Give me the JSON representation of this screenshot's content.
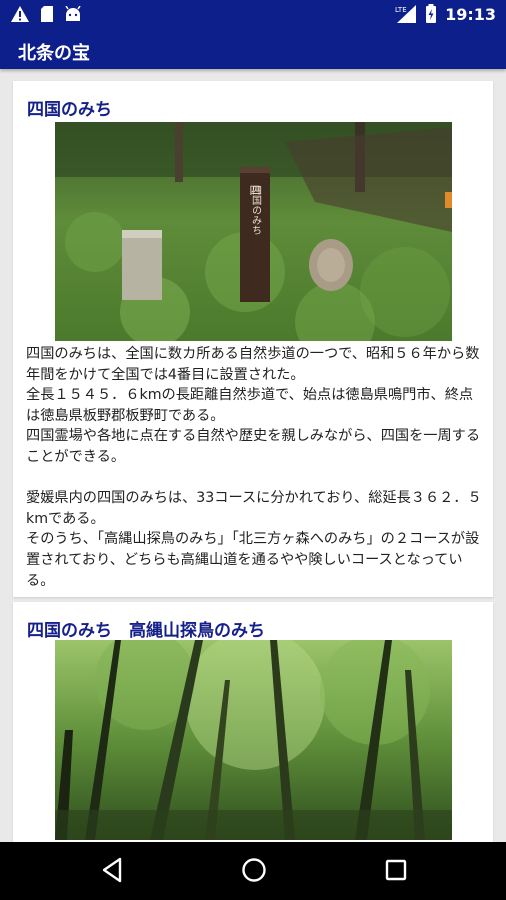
{
  "status_bar": {
    "time": "19:13",
    "network": "LTE",
    "icons": [
      "warning-icon",
      "sd-card-icon",
      "android-icon",
      "lte-signal-icon",
      "battery-charging-icon"
    ]
  },
  "app_bar": {
    "title": "北条の宝"
  },
  "cards": [
    {
      "title": "四国のみち",
      "photo": {
        "sign_label": "四国のみち",
        "sign_top": "四"
      },
      "description": "四国のみちは、全国に数カ所ある自然歩道の一つで、昭和５６年から数年間をかけて全国では4番目に設置された。\n全長１５４５．６kmの長距離自然歩道で、始点は徳島県鳴門市、終点は徳島県板野郡板野町である。\n四国霊場や各地に点在する自然や歴史を親しみながら、四国を一周することができる。\n\n愛媛県内の四国のみちは、33コースに分かれており、総延長３６２．５kmである。\nそのうち、「高縄山探鳥のみち」「北三方ヶ森へのみち」の２コースが設置されており、どちらも高縄山道を通るやや険しいコースとなっている。"
    },
    {
      "title": "四国のみち　高縄山探鳥のみち"
    }
  ],
  "nav_bar": {
    "buttons": [
      "back-icon",
      "home-icon",
      "recents-icon"
    ]
  },
  "colors": {
    "primary": "#0d1f8a",
    "title_text": "#15208a",
    "background": "#e9e9e9"
  }
}
